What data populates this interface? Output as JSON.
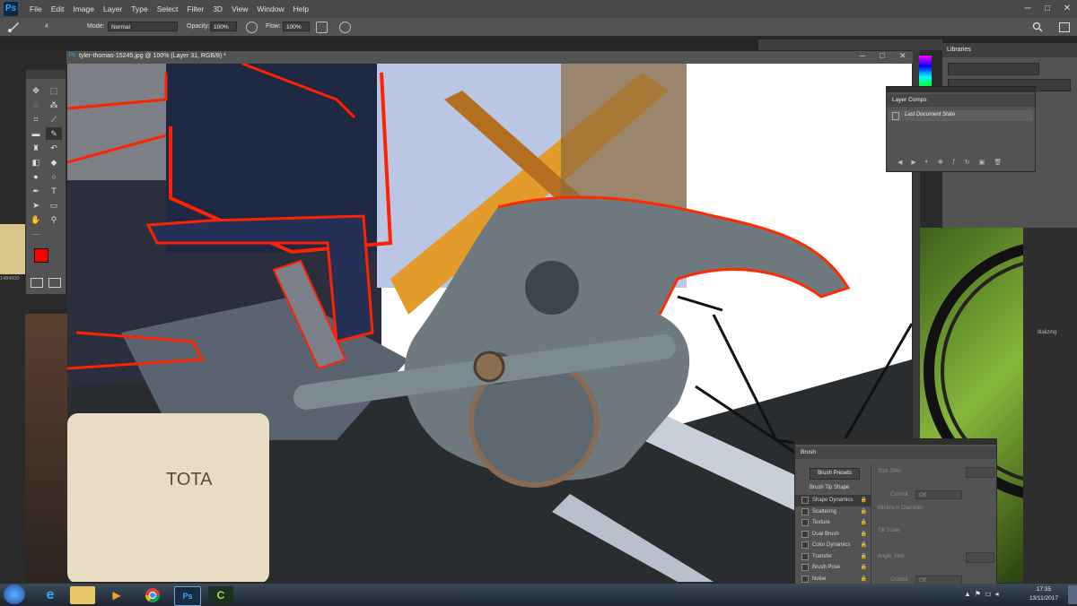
{
  "app": {
    "logo": "Ps"
  },
  "menu": [
    "File",
    "Edit",
    "Image",
    "Layer",
    "Type",
    "Select",
    "Filter",
    "3D",
    "View",
    "Window",
    "Help"
  ],
  "window_controls": [
    "─",
    "□",
    "✕"
  ],
  "options_bar": {
    "mode_label": "Mode:",
    "mode_value": "Normal",
    "opacity_label": "Opacity:",
    "opacity_value": "100%",
    "flow_label": "Flow:",
    "flow_value": "100%",
    "brush_size": "4"
  },
  "document": {
    "title": "tyler-thomas-15245.jpg @ 100% (Layer 31, RGB/8) *"
  },
  "layer_comps": {
    "title": "Layer Comps",
    "item": "Last Document State"
  },
  "libraries": {
    "title": "Libraries"
  },
  "brush_panel": {
    "title": "Brush",
    "presets_button": "Brush Presets",
    "tip_shape": "Brush Tip Shape",
    "items": [
      "Shape Dynamics",
      "Scattering",
      "Texture",
      "Dual Brush",
      "Color Dynamics",
      "Transfer",
      "Brush Pose",
      "Noise"
    ],
    "size_jitter": "Size Jitter",
    "control_label": "Control:",
    "control_value": "Off",
    "min_diameter": "Minimum Diameter",
    "tilt_scale": "Tilt Scale",
    "angle_jitter": "Angle Jitter",
    "control2_value": "Off"
  },
  "background_text": {
    "left_number": "1484600",
    "right_status": "itializing"
  },
  "taskbar": {
    "time": "17:35",
    "date": "13/11/2017"
  },
  "colors": {
    "foreground": "#ff0000",
    "background": "#ffffff",
    "ps_blue": "#31a8ff",
    "panel": "#535353"
  },
  "icons": [
    "brush-icon",
    "move-icon",
    "marquee-icon",
    "lasso-icon",
    "magic-wand-icon",
    "crop-icon",
    "eyedropper-icon",
    "healing-icon",
    "clone-stamp-icon",
    "history-brush-icon",
    "eraser-icon",
    "paint-bucket-icon",
    "blur-icon",
    "dodge-icon",
    "pen-icon",
    "type-icon",
    "path-select-icon",
    "shape-icon",
    "hand-icon",
    "zoom-icon"
  ]
}
